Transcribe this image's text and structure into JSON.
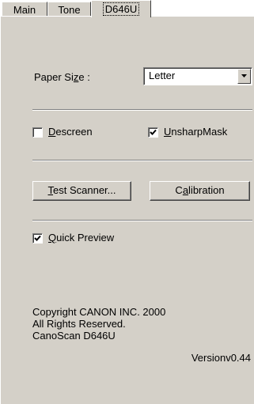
{
  "tabs": [
    {
      "label": "Main",
      "selected": false
    },
    {
      "label": "Tone",
      "selected": false
    },
    {
      "label": "D646U",
      "selected": true
    }
  ],
  "paper_size": {
    "label_before": "Paper Si",
    "label_accel": "z",
    "label_after": "e :",
    "value": "Letter"
  },
  "descreen": {
    "accel": "D",
    "rest": "escreen",
    "checked": false
  },
  "unsharp": {
    "accel": "U",
    "rest": "nsharpMask",
    "checked": true
  },
  "test_scanner": {
    "accel": "T",
    "rest": "est Scanner..."
  },
  "calibration": {
    "before": "C",
    "accel": "a",
    "after": "libration"
  },
  "quick_preview": {
    "accel": "Q",
    "rest": "uick Preview",
    "checked": true
  },
  "copyright": {
    "line1": "Copyright CANON INC. 2000",
    "line2": "All Rights Reserved.",
    "line3": "CanoScan D646U"
  },
  "version": "Versionv0.44",
  "colors": {
    "face": "#d4d0c8",
    "highlight": "#ffffff",
    "shadow": "#808080",
    "dark_shadow": "#404040"
  }
}
